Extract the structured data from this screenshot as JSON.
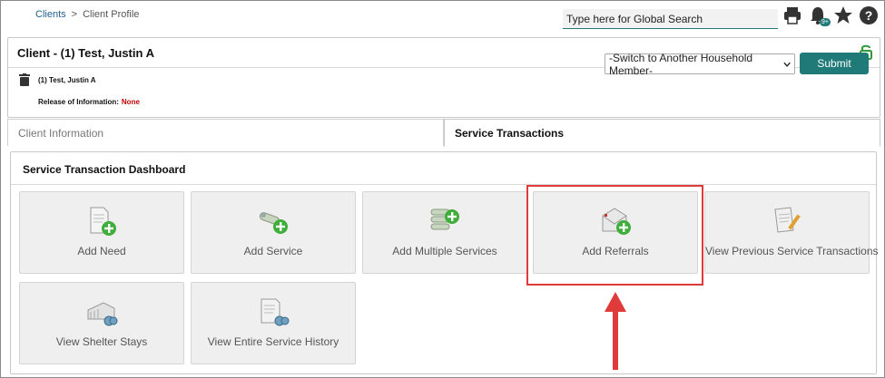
{
  "breadcrumb": {
    "clients": "Clients",
    "separator": ">",
    "current": "Client Profile"
  },
  "search": {
    "placeholder": "Type here for Global Search"
  },
  "notifications": {
    "badge": "9+"
  },
  "client": {
    "title": "Client - (1) Test, Justin A",
    "name": "(1) Test, Justin A",
    "roi_label": "Release of Information:",
    "roi_value": "None"
  },
  "household": {
    "selected": "-Switch to Another Household Member-"
  },
  "submit_label": "Submit",
  "tabs": [
    {
      "label": "Client Information",
      "active": false
    },
    {
      "label": "Service Transactions",
      "active": true
    }
  ],
  "dashboard": {
    "title": "Service Transaction Dashboard",
    "tiles": [
      {
        "label": "Add Need",
        "icon": "add-need-icon"
      },
      {
        "label": "Add Service",
        "icon": "add-service-icon"
      },
      {
        "label": "Add Multiple Services",
        "icon": "add-multiple-services-icon"
      },
      {
        "label": "Add Referrals",
        "icon": "add-referrals-icon"
      },
      {
        "label": "View Previous Service Transactions",
        "icon": "view-previous-transactions-icon"
      },
      {
        "label": "View Shelter Stays",
        "icon": "shelter-stays-icon"
      },
      {
        "label": "View Entire Service History",
        "icon": "service-history-icon"
      }
    ]
  },
  "colors": {
    "accent": "#1f7a78",
    "highlight": "#e03b3b",
    "none_text": "#c00000",
    "link": "#1f5f8b"
  }
}
